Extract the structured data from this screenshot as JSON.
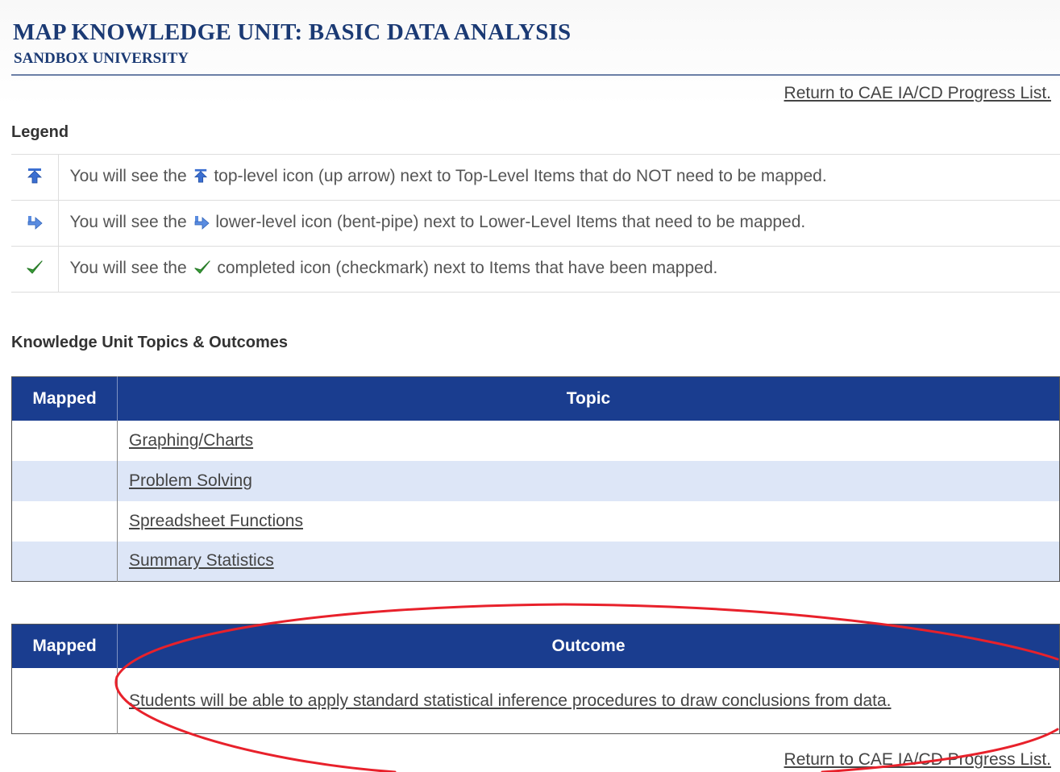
{
  "header": {
    "title": "MAP KNOWLEDGE UNIT: BASIC DATA ANALYSIS",
    "subtitle": "SANDBOX UNIVERSITY",
    "return_link": "Return to CAE IA/CD Progress List."
  },
  "legend": {
    "heading": "Legend",
    "rows": [
      {
        "icon": "up-arrow-icon",
        "prefix": "You will see the",
        "suffix": "top-level icon (up arrow) next to Top-Level Items that do NOT need to be mapped."
      },
      {
        "icon": "bent-pipe-icon",
        "prefix": "You will see the",
        "suffix": "lower-level icon (bent-pipe) next to Lower-Level Items that need to be mapped."
      },
      {
        "icon": "checkmark-icon",
        "prefix": "You will see the",
        "suffix": "completed icon (checkmark) next to Items that have been mapped."
      }
    ]
  },
  "topics_section": {
    "heading": "Knowledge Unit Topics & Outcomes",
    "columns": [
      "Mapped",
      "Topic"
    ],
    "rows": [
      {
        "mapped": "",
        "topic": "Graphing/Charts"
      },
      {
        "mapped": "",
        "topic": "Problem Solving"
      },
      {
        "mapped": "",
        "topic": "Spreadsheet Functions"
      },
      {
        "mapped": "",
        "topic": "Summary Statistics"
      }
    ]
  },
  "outcomes_section": {
    "columns": [
      "Mapped",
      "Outcome"
    ],
    "rows": [
      {
        "mapped": "",
        "outcome": "Students will be able to apply standard statistical inference procedures to draw conclusions from data."
      }
    ]
  },
  "footer": {
    "return_link": "Return to CAE IA/CD Progress List."
  },
  "colors": {
    "title_navy": "#1b3a74",
    "table_header_blue": "#1a3d8f",
    "alt_row_blue": "#dde6f7",
    "annotation_red": "#e8212b",
    "up_arrow_blue": "#3b6fd1",
    "bent_pipe_blue": "#5a8ce0",
    "checkmark_green": "#3aa13a"
  }
}
